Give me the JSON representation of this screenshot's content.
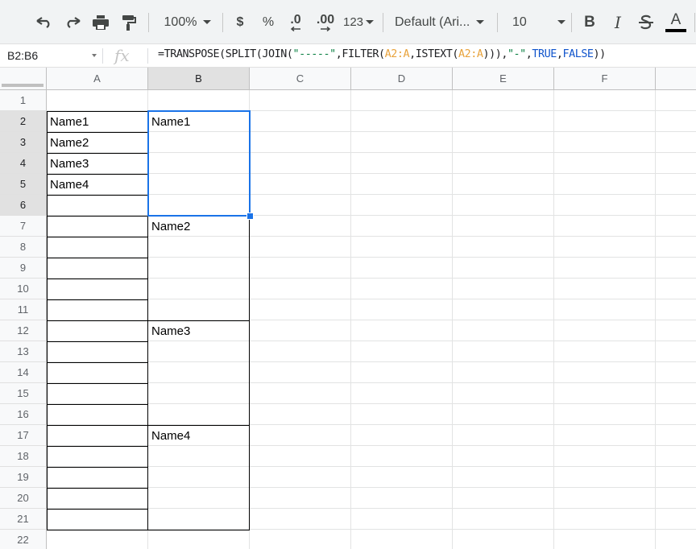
{
  "toolbar": {
    "zoom": "100%",
    "currency": "$",
    "percent": "%",
    "decrease_decimal": ".0",
    "increase_decimal": ".00",
    "number_format": "123",
    "font": "Default (Ari...",
    "font_size": "10",
    "bold": "B",
    "italic": "I",
    "text_color": "A",
    "text_color_hex": "#000000"
  },
  "formula_bar": {
    "name_box": "B2:B6",
    "fx": "fx",
    "formula_tokens": [
      {
        "t": "=TRANSPOSE(SPLIT(JOIN(",
        "k": "plain"
      },
      {
        "t": "\"-----\"",
        "k": "str"
      },
      {
        "t": ",FILTER(",
        "k": "plain"
      },
      {
        "t": "A2:A",
        "k": "ref"
      },
      {
        "t": ",ISTEXT(",
        "k": "plain"
      },
      {
        "t": "A2:A",
        "k": "ref"
      },
      {
        "t": "))),",
        "k": "plain"
      },
      {
        "t": "\"-\"",
        "k": "str"
      },
      {
        "t": ",",
        "k": "plain"
      },
      {
        "t": "TRUE",
        "k": "bool"
      },
      {
        "t": ",",
        "k": "plain"
      },
      {
        "t": "FALSE",
        "k": "bool"
      },
      {
        "t": "))",
        "k": "plain"
      }
    ]
  },
  "grid": {
    "columns": [
      "A",
      "B",
      "C",
      "D",
      "E",
      "F"
    ],
    "selected_column": "B",
    "rows": [
      "1",
      "2",
      "3",
      "4",
      "5",
      "6",
      "7",
      "8",
      "9",
      "10",
      "11",
      "12",
      "13",
      "14",
      "15",
      "16",
      "17",
      "18",
      "19",
      "20",
      "21",
      "22"
    ],
    "selected_rows": [
      "2",
      "3",
      "4",
      "5",
      "6"
    ],
    "column_a": [
      {
        "row": 2,
        "value": "Name1"
      },
      {
        "row": 3,
        "value": "Name2"
      },
      {
        "row": 4,
        "value": "Name3"
      },
      {
        "row": 5,
        "value": "Name4"
      }
    ],
    "merged_b": [
      {
        "row": 2,
        "value": "Name1"
      },
      {
        "row": 7,
        "value": "Name2"
      },
      {
        "row": 12,
        "value": "Name3"
      },
      {
        "row": 17,
        "value": "Name4"
      }
    ],
    "colors": {
      "selection": "#1a73e8",
      "formula_string": "#0b8043",
      "formula_ref": "#e8a33d",
      "formula_bool": "#1155cc"
    }
  }
}
